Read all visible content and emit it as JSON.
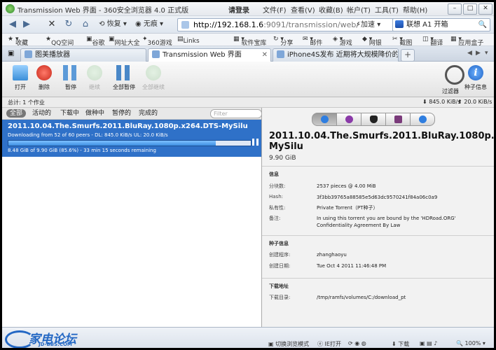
{
  "window": {
    "title": "Transmission Web 界面 - 360安全浏览器 4.0 正式版",
    "login": "请登录",
    "menu": [
      "文件(F)",
      "查看(V)",
      "收藏(B)",
      "帐户(T)",
      "工具(T)",
      "帮助(H)"
    ]
  },
  "nav": {
    "restore": "恢复",
    "wuhen": "无痕",
    "url_host": "http://192.168.1.6",
    "url_rest": ":9091/transmission/web/",
    "speedup": "加速",
    "search_value": "联想 A1 开箱"
  },
  "bookmarks": [
    "收藏",
    "QQ空间",
    "谷歌",
    "网址大全",
    "360游戏",
    "Links",
    "软件宝库",
    "分享",
    "邮件",
    "游戏",
    "网银",
    "截图",
    "翻译",
    "应用盒子"
  ],
  "tabs": [
    {
      "label": "图美播放器"
    },
    {
      "label": "Transmission Web 界面"
    },
    {
      "label": "iPhone4S发布 近期将大规模降价的..."
    }
  ],
  "toolbar": {
    "open": "打开",
    "remove": "删除",
    "pause": "暂停",
    "resume": "继续",
    "pause_all": "全部暂停",
    "resume_all": "全部继续",
    "filter": "过滤器",
    "inspector": "种子信息"
  },
  "status": {
    "count": "总计: 1 个作业",
    "download": "845.0 KiB/s",
    "upload": "20.0 KiB/s"
  },
  "filters": {
    "all": "全部",
    "active": "活动的",
    "downloading": "下载中",
    "seeding": "做种中",
    "paused": "暂停的",
    "finished": "完成的",
    "placeholder": "Filter"
  },
  "torrent": {
    "name": "2011.10.04.The.Smurfs.2011.BluRay.1080p.x264.DTS-MySilu",
    "peers": "Downloading from 52 of 60 peers - DL: 845.0 KiB/s UL: 20.0 KiB/s",
    "progress": "8.48 GiB of 9.90 GiB (85.6%) - 33 min 15 seconds remaining",
    "percent": 85.6
  },
  "inspector": {
    "name": "2011.10.04.The.Smurfs.2011.BluRay.1080p.x264.DTS-MySilu",
    "size": "9.90 GiB",
    "info_title": "信息",
    "pieces_label": "分块数:",
    "pieces_value": "2537 pieces @ 4.00 MiB",
    "hash_label": "Hash:",
    "hash_value": "3f3bb39765a88585e5d63dc9570241f84a06c0a9",
    "secure_label": "私有性:",
    "secure_value": "Private Torrent（PT种子）",
    "comment_label": "备注:",
    "comment_value": "In using this torrent you are bound by the 'HDRoad.ORG' Confidentiality Agreement By Law",
    "origin_title": "种子信息",
    "creator_label": "创建程序:",
    "creator_value": "zhanghaoyu",
    "date_label": "创建日期:",
    "date_value": "Tue Oct 4 2011 11:46:48 PM",
    "where_title": "下载地址",
    "dir_label": "下载目录:",
    "dir_value": "/tmp/ramfs/volumes/C:/download_pt"
  },
  "browser_status": {
    "logo_text": "家电论坛",
    "logo_site": "JD-BBS.COM",
    "mode": "切换浏览模式",
    "ie": "IE打开",
    "download": "下载",
    "zoom": "100%"
  }
}
